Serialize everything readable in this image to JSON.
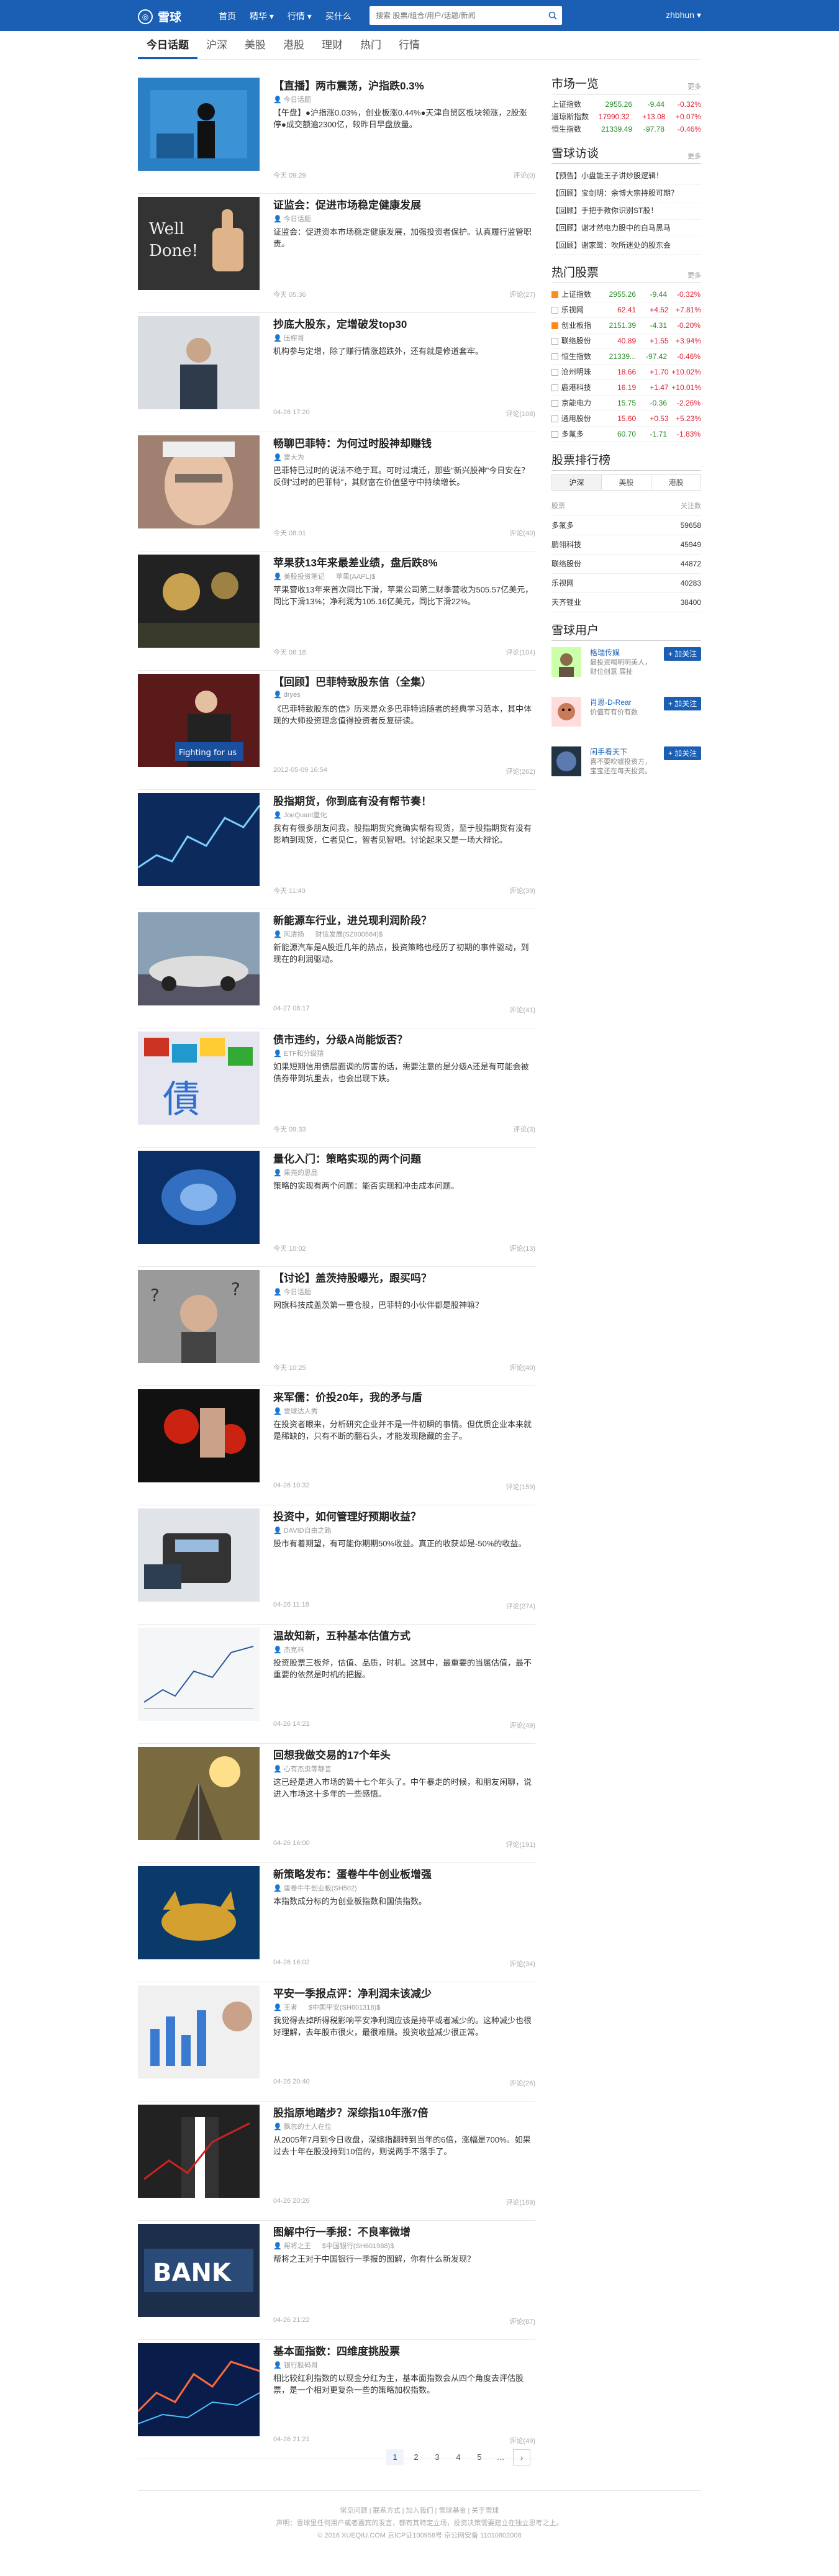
{
  "header": {
    "logo_text": "雪球",
    "nav": [
      "首页",
      "精华 ▾",
      "行情 ▾",
      "买什么"
    ],
    "search_placeholder": "搜索 股票/组合/用户/话题/新闻",
    "user": "zhbhun ▾"
  },
  "tabs": [
    "今日话题",
    "沪深",
    "美股",
    "港股",
    "理财",
    "热门",
    "行情"
  ],
  "feed": [
    {
      "title": "【直播】两市震荡，沪指跌0.3%",
      "author": "今日话题",
      "summary": "【午盘】●沪指涨0.03%，创业板涨0.44%●天津自贸区板块领涨，2股涨停●成交额逾2300亿，较昨日早盘放量。",
      "time": "今天 09:29",
      "comments": "评论(0)"
    },
    {
      "title": "证监会：促进市场稳定健康发展",
      "author": "今日话题",
      "summary": "证监会：促进资本市场稳定健康发展，加强投资者保护。认真履行监管职责。",
      "time": "今天 05:36",
      "comments": "评论(27)"
    },
    {
      "title": "抄底大股东，定增破发top30",
      "author": "压榨哥",
      "summary": "机构参与定增，除了赚行情涨超跌外，还有就是修道套牢。",
      "time": "04-26 17:20",
      "comments": "评论(108)"
    },
    {
      "title": "畅聊巴菲特：为何过时股神却赚钱",
      "author": "雷大为",
      "summary": "巴菲特已过时的说法不绝于耳。可时过境迁，那些\"新兴股神\"今日安在？反倒\"过时的巴菲特\"，其财富在价值坚守中持续增长。",
      "time": "今天 08:01",
      "comments": "评论(40)"
    },
    {
      "title": "苹果获13年来最差业绩，盘后跌8%",
      "author": "美股投资笔记",
      "author2": "苹果(AAPL)$",
      "summary": "苹果营收13年来首次同比下滑，苹果公司第二财季营收为505.57亿美元，同比下滑13%；净利润为105.16亿美元，同比下滑22%。",
      "time": "今天 06:18",
      "comments": "评论(104)"
    },
    {
      "title": "【回顾】巴菲特致股东信（全集）",
      "author": "dryes",
      "summary": "《巴菲特致股东的信》历来是众多巴菲特追随者的经典学习范本，其中体现的大师投资理念值得投资者反复研读。",
      "time": "2012-05-09 16:54",
      "comments": "评论(262)"
    },
    {
      "title": "股指期货，你到底有没有帮节奏！",
      "author": "JoeQuant量化",
      "summary": "我有有很多朋友问我，股指期货究竟确实帮有现货，至于股指期货有没有影响到现货，仁者见仁，智者见智吧。讨论起来又是一场大辩论。",
      "time": "今天 11:40",
      "comments": "评论(39)"
    },
    {
      "title": "新能源车行业，进兑现利润阶段？",
      "author": "风清扬",
      "author2": "财信发展(SZ000564)$",
      "summary": "新能源汽车是A股近几年的热点，投资策略也经历了初期的事件驱动，到现在的利润驱动。",
      "time": "04-27 08:17",
      "comments": "评论(41)"
    },
    {
      "title": "债市违约，分级A尚能饭否？",
      "author": "ETF和分级猿",
      "summary": "如果短期信用债层面调的厉害的话，需要注意的是分级A还是有可能会被债券带到坑里去，也会出现下跌。",
      "time": "今天 09:33",
      "comments": "评论(3)"
    },
    {
      "title": "量化入门：策略实现的两个问题",
      "author": "果壳的思品",
      "summary": "策略的实现有两个问题：能否实现和冲击成本问题。",
      "time": "今天 10:02",
      "comments": "评论(13)"
    },
    {
      "title": "【讨论】盖茨持股曝光，跟买吗？",
      "author": "今日话题",
      "summary": "网旗科技成盖茨第一重仓股，巴菲特的小伙伴都是股神嘛？",
      "time": "今天 10:25",
      "comments": "评论(40)"
    },
    {
      "title": "来军儒：价投20年，我的矛与盾",
      "author": "雪球达人秀",
      "summary": "在投资者眼来，分析研究企业并不是一件初瞬的事情。但优质企业本来就是稀缺的，只有不断的翻石头，才能发现隐藏的金子。",
      "time": "04-26 10:32",
      "comments": "评论(159)"
    },
    {
      "title": "投资中，如何管理好预期收益？",
      "author": "DAVID自由之路",
      "summary": "股市有着期望，有可能你期期50%收益。真正的收获却是-50%的收益。",
      "time": "04-26 11:18",
      "comments": "评论(274)"
    },
    {
      "title": "温故知新，五种基本估值方式",
      "author": "杰克林",
      "summary": "投资股票三板斧，估值、品质，时机。这其中，最重要的当属估值，最不重要的依然是时机的把握。",
      "time": "04-26 14:21",
      "comments": "评论(49)"
    },
    {
      "title": "回想我做交易的17个年头",
      "author": "心有杰虫等静言",
      "summary": "这已经是进入市场的第十七个年头了。中午暴走的时候，和朋友闲聊，说进入市场这十多年的一些感悟。",
      "time": "04-26 16:00",
      "comments": "评论(191)"
    },
    {
      "title": "新策略发布：蛋卷牛牛创业板增强",
      "author": "蛋卷牛牛创业板(SH502)",
      "summary": "本指数成分标的为创业板指数和国债指数。",
      "time": "04-26 16:02",
      "comments": "评论(34)"
    },
    {
      "title": "平安一季报点评：净利润未该减少",
      "author": "王者",
      "author2": "$中国平安(SH601318)$",
      "summary": "我觉得去掉所得税影响平安净利润应该是持平或者减少的。这种减少也很好理解，去年股市很火，最很难赚。投资收益减少很正常。",
      "time": "04-26 20:40",
      "comments": "评论(26)"
    },
    {
      "title": "股指原地踏步？深综指10年涨7倍",
      "author": "飘忽的土人在位",
      "summary": "从2005年7月到今日收盘，深综指翻转到当年的6倍，涨幅是700%。如果过去十年在股没持到10倍的，则说两手不落手了。",
      "time": "04-26 20:26",
      "comments": "评论(169)"
    },
    {
      "title": "图解中行一季报：不良率微增",
      "author": "帮将之王",
      "author2": "$中国银行(SH601988)$",
      "summary": "帮将之王对于中国银行一季报的图解，你有什么新发现？",
      "time": "04-26 21:22",
      "comments": "评论(87)"
    },
    {
      "title": "基本面指数：四维度挑股票",
      "author": "银行股码哥",
      "summary": "相比较红利指数的以现金分红为主，基本面指数会从四个角度去评估股票，是一个相对更复杂一些的策略加权指数。",
      "time": "04-26 21:21",
      "comments": "评论(49)"
    }
  ],
  "pager": [
    "1",
    "2",
    "3",
    "4",
    "5",
    "…",
    "›"
  ],
  "market": {
    "title": "市场一览",
    "more": "更多",
    "rows": [
      {
        "name": "上证指数",
        "price": "2955.26",
        "change": "-9.44",
        "pct": "-0.32%"
      },
      {
        "name": "道琼斯指数",
        "price": "17990.32",
        "change": "+13.08",
        "pct": "+0.07%"
      },
      {
        "name": "恒生指数",
        "price": "21339.49",
        "change": "-97.78",
        "pct": "-0.46%"
      }
    ]
  },
  "visits": {
    "title": "雪球访谈",
    "more": "更多",
    "items": [
      "【预告】小盘能王子讲炒股逻辑！",
      "【回顾】宝剑明：余博大宗持股可期？",
      "【回顾】手把手教你识别ST股！",
      "【回顾】谢才然电力股中的白马黑马",
      "【回顾】谢家鹭：吹所迷处的股东会"
    ]
  },
  "hot_stocks": {
    "title": "热门股票",
    "more": "更多",
    "rows": [
      {
        "name": "上证指数",
        "price": "2955.26",
        "change": "-9.44",
        "pct": "-0.32%",
        "on": true
      },
      {
        "name": "乐视网",
        "price": "62.41",
        "change": "+4.52",
        "pct": "+7.81%",
        "on": false
      },
      {
        "name": "创业板指",
        "price": "2151.39",
        "change": "-4.31",
        "pct": "-0.20%",
        "on": true
      },
      {
        "name": "联络股份",
        "price": "40.89",
        "change": "+1.55",
        "pct": "+3.94%",
        "on": false
      },
      {
        "name": "恒生指数",
        "price": "21339...",
        "change": "-97.42",
        "pct": "-0.46%",
        "on": false
      },
      {
        "name": "沧州明珠",
        "price": "18.66",
        "change": "+1.70",
        "pct": "+10.02%",
        "on": false
      },
      {
        "name": "鹿港科技",
        "price": "16.19",
        "change": "+1.47",
        "pct": "+10.01%",
        "on": false
      },
      {
        "name": "京能电力",
        "price": "15.75",
        "change": "-0.36",
        "pct": "-2.26%",
        "on": false
      },
      {
        "name": "通用股份",
        "price": "15.60",
        "change": "+0.53",
        "pct": "+5.23%",
        "on": false
      },
      {
        "name": "多氟多",
        "price": "60.70",
        "change": "-1.71",
        "pct": "-1.83%",
        "on": false
      }
    ]
  },
  "rank": {
    "title": "股票排行榜",
    "tabs": [
      "沪深",
      "美股",
      "港股"
    ],
    "head": [
      "股票",
      "关注数"
    ],
    "rows": [
      {
        "name": "多氟多",
        "count": "59658"
      },
      {
        "name": "鹏翎科技",
        "count": "45949"
      },
      {
        "name": "联络股份",
        "count": "44872"
      },
      {
        "name": "乐视网",
        "count": "40283"
      },
      {
        "name": "天齐锂业",
        "count": "38400"
      }
    ]
  },
  "users": {
    "title": "雪球用户",
    "follow": "+ 加关注",
    "items": [
      {
        "name": "格瑞传媒",
        "desc": "最投资喝明明美人，财位创意 展扯"
      },
      {
        "name": "肖恩-D-Rear",
        "desc": "价值有有价有数"
      },
      {
        "name": "闲手看天下",
        "desc": "喜不要吹嘘投资方，宝宝还在每天投资。"
      }
    ]
  },
  "footer": {
    "links": "常见问题 | 联系方式 | 加入我们 | 雪球基金 | 关于雪球",
    "disclaimer": "声明：雪球里任何用户或者嘉宾的发言，都有其特定立场，投资决策需要建立在独立思考之上。",
    "copyright": "© 2016 XUEQIU.COM  京ICP证100958号  京公网安备 11010802008"
  },
  "colors": {
    "brand": "#1a5fb4",
    "up": "#d22233",
    "down": "#2a8a2a"
  }
}
